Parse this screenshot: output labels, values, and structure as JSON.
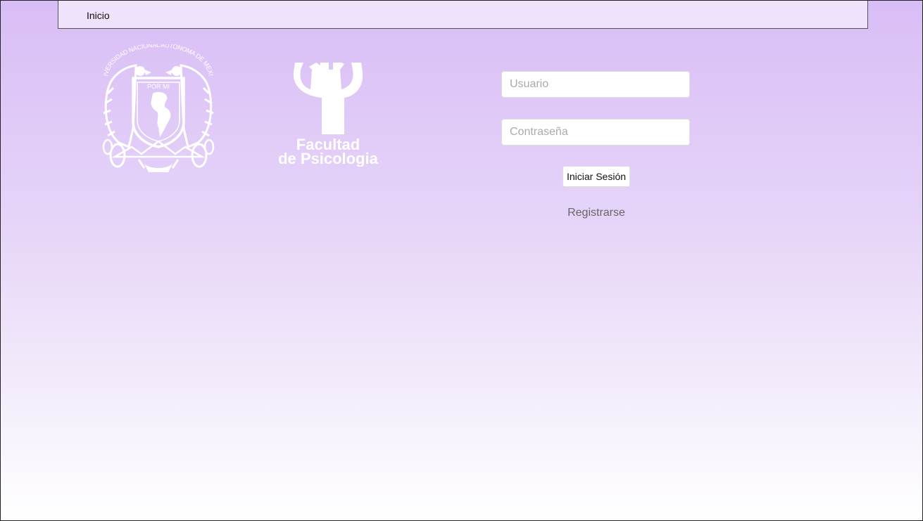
{
  "nav": {
    "home_label": "Inicio"
  },
  "logos": {
    "unam": {
      "ring_text": "UNIVERSIDAD NACIONAL AUTONOMA DE MEXICO",
      "shield_text": "POR MI"
    },
    "psicologia": {
      "line1": "Facultad",
      "line2": "de Psicologia"
    }
  },
  "login": {
    "username_placeholder": "Usuario",
    "password_placeholder": "Contraseña",
    "submit_label": "Iniciar Sesión",
    "register_label": "Registrarse"
  },
  "colors": {
    "gradient_top": "#d9bdf6",
    "gradient_bottom": "#ffffff",
    "nav_bg": "#efe2fb"
  }
}
